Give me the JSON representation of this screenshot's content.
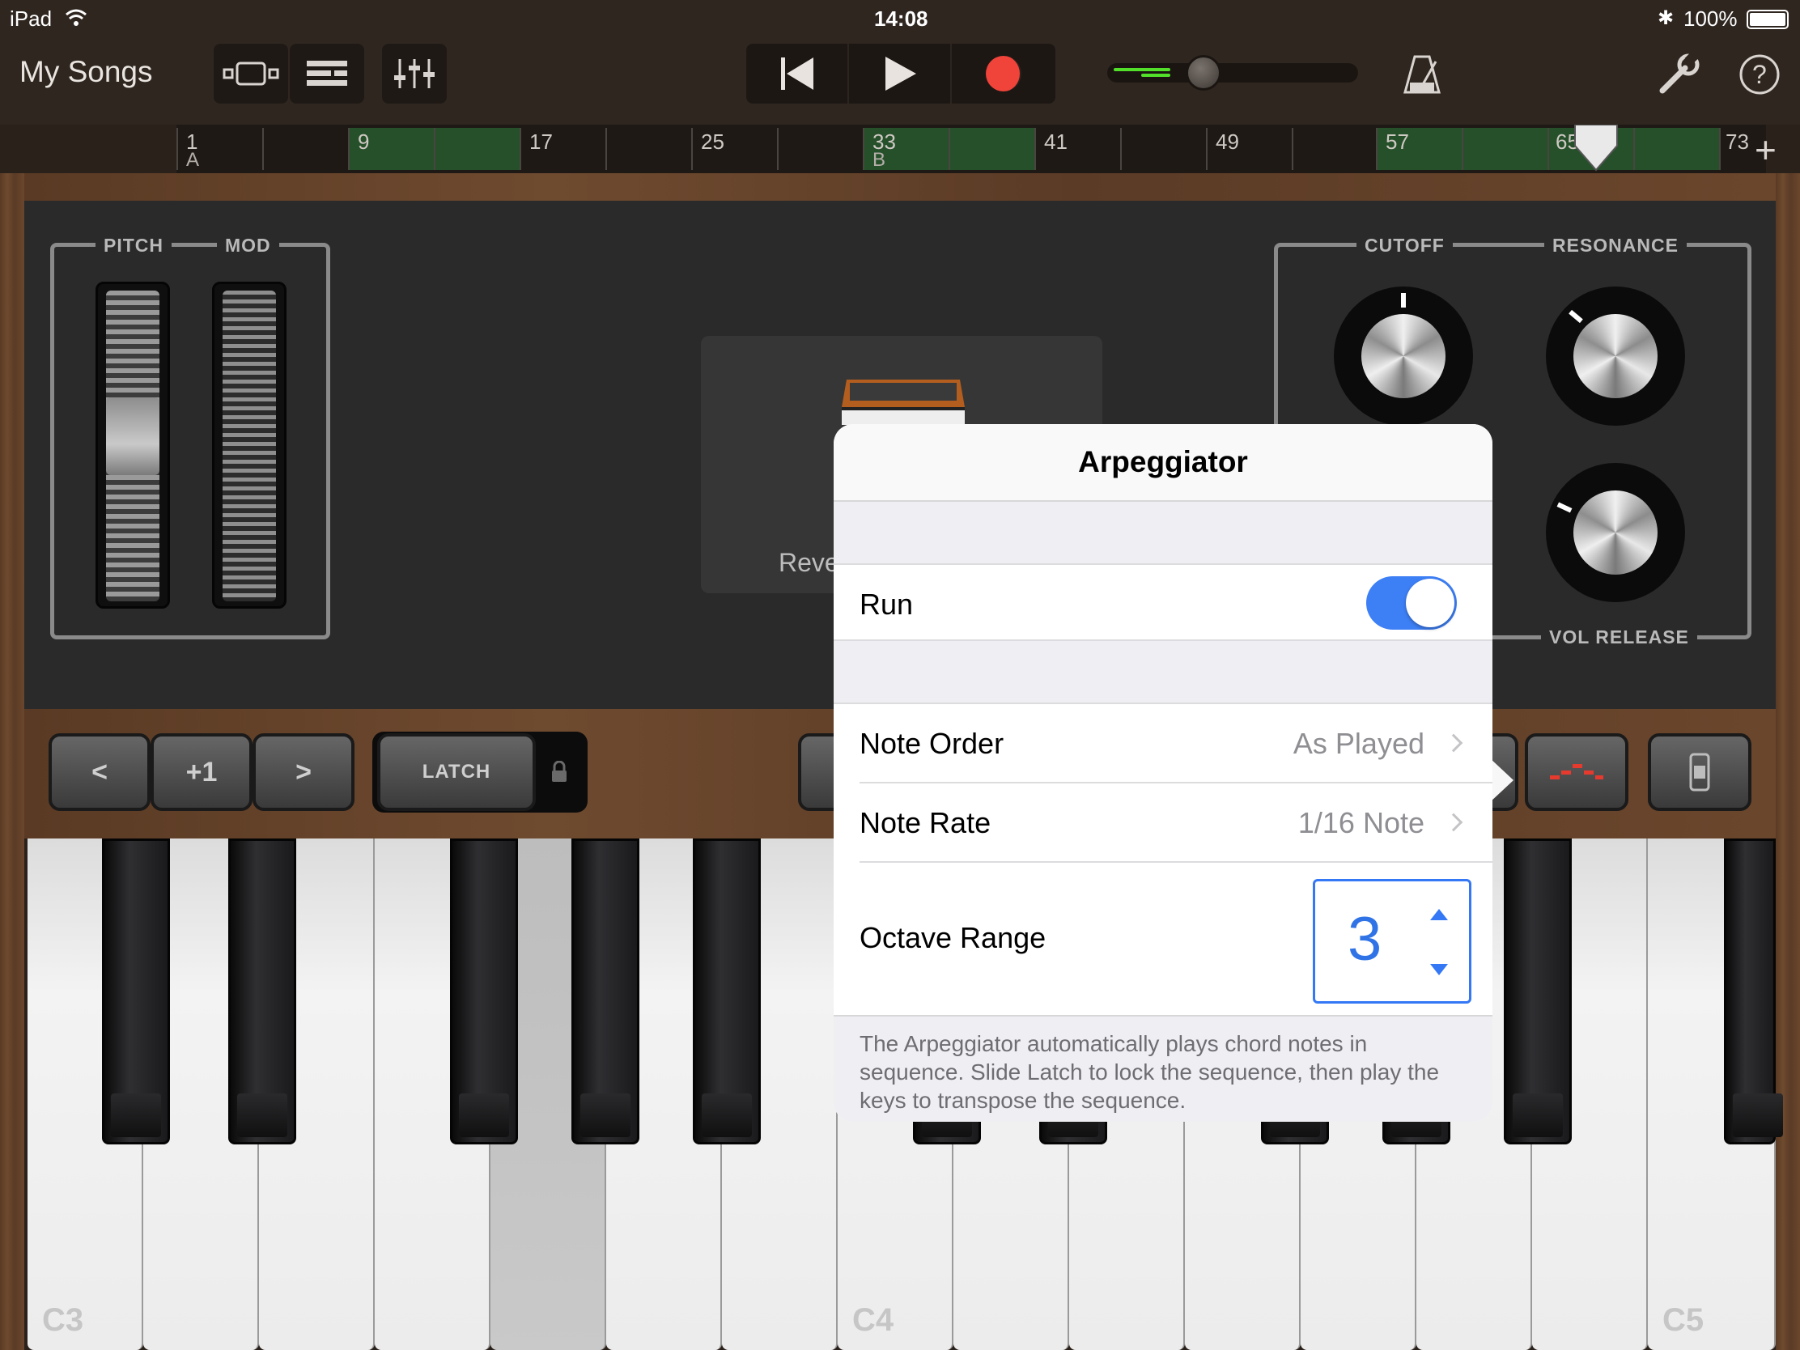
{
  "status_bar": {
    "device": "iPad",
    "time": "14:08",
    "battery": "100%"
  },
  "toolbar": {
    "my_songs": "My Songs",
    "icons": [
      "browser-view-icon",
      "tracks-view-icon",
      "mixer-icon",
      "rewind-icon",
      "play-icon",
      "record-icon",
      "metronome-icon",
      "settings-wrench-icon",
      "help-icon"
    ],
    "record_color": "#f0433a",
    "volume_level": 0.27
  },
  "ruler": {
    "bars": [
      "1",
      "9",
      "17",
      "25",
      "33",
      "41",
      "49",
      "57",
      "65",
      "73"
    ],
    "sections": [
      "A",
      "B"
    ],
    "region_color": "#25502a"
  },
  "synth": {
    "pitch_label": "PITCH",
    "mod_label": "MOD",
    "cutoff_label": "CUTOFF",
    "resonance_label": "RESONANCE",
    "vol_release_label": "VOL RELEASE",
    "instrument_label_partial": "Reve"
  },
  "controls": {
    "octave_down": "<",
    "octave_value": "+1",
    "octave_up": ">",
    "latch": "LATCH"
  },
  "keyboard": {
    "notes": [
      "C3",
      "C4",
      "C5"
    ]
  },
  "arpeggiator": {
    "title": "Arpeggiator",
    "run_label": "Run",
    "run_on": true,
    "note_order_label": "Note Order",
    "note_order_value": "As Played",
    "note_rate_label": "Note Rate",
    "note_rate_value": "1/16 Note",
    "octave_range_label": "Octave Range",
    "octave_range_value": "3",
    "description": "The Arpeggiator automatically plays chord notes in sequence. Slide Latch to lock the sequence, then play the keys to transpose the sequence.",
    "accent_color": "#3478f6"
  }
}
